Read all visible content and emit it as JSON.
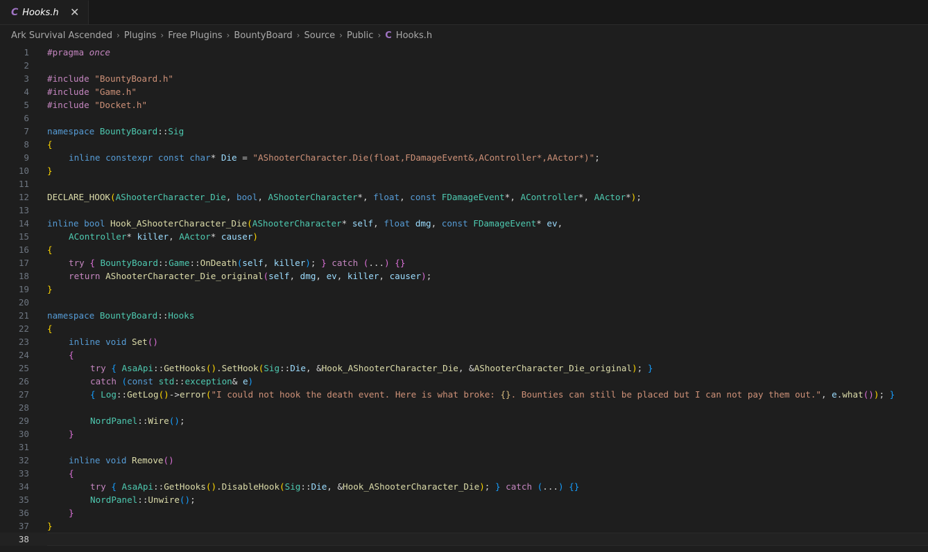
{
  "tab": {
    "icon": "C",
    "title": "Hooks.h",
    "close": "✕"
  },
  "breadcrumbs": [
    "Ark Survival Ascended",
    "Plugins",
    "Free Plugins",
    "BountyBoard",
    "Source",
    "Public"
  ],
  "breadcrumb_file": {
    "icon": "C",
    "label": "Hooks.h"
  },
  "breadcrumb_separator": "›",
  "editor": {
    "current_line": 38,
    "lines": [
      {
        "n": "1",
        "indent": 0,
        "tokens": [
          [
            "pp",
            "#pragma "
          ],
          [
            "pp it",
            "once"
          ]
        ]
      },
      {
        "n": "2",
        "indent": 0,
        "tokens": []
      },
      {
        "n": "3",
        "indent": 0,
        "tokens": [
          [
            "pp",
            "#include "
          ],
          [
            "str",
            "\"BountyBoard.h\""
          ]
        ]
      },
      {
        "n": "4",
        "indent": 0,
        "tokens": [
          [
            "pp",
            "#include "
          ],
          [
            "str",
            "\"Game.h\""
          ]
        ]
      },
      {
        "n": "5",
        "indent": 0,
        "tokens": [
          [
            "pp",
            "#include "
          ],
          [
            "str",
            "\"Docket.h\""
          ]
        ]
      },
      {
        "n": "6",
        "indent": 0,
        "tokens": []
      },
      {
        "n": "7",
        "indent": 0,
        "tokens": [
          [
            "kw",
            "namespace "
          ],
          [
            "ty",
            "BountyBoard"
          ],
          [
            "pl",
            "::"
          ],
          [
            "ty",
            "Sig"
          ]
        ]
      },
      {
        "n": "8",
        "indent": 0,
        "tokens": [
          [
            "br1",
            "{"
          ]
        ]
      },
      {
        "n": "9",
        "indent": 1,
        "tokens": [
          [
            "kw",
            "inline constexpr const char"
          ],
          [
            "pl",
            "* "
          ],
          [
            "var",
            "Die"
          ],
          [
            "pl",
            " = "
          ],
          [
            "str",
            "\"AShooterCharacter.Die(float,FDamageEvent&,AController*,AActor*)\""
          ],
          [
            "pl",
            ";"
          ]
        ]
      },
      {
        "n": "10",
        "indent": 0,
        "tokens": [
          [
            "br1",
            "}"
          ]
        ]
      },
      {
        "n": "11",
        "indent": 0,
        "tokens": []
      },
      {
        "n": "12",
        "indent": 0,
        "tokens": [
          [
            "fn",
            "DECLARE_HOOK"
          ],
          [
            "br1",
            "("
          ],
          [
            "ty",
            "AShooterCharacter_Die"
          ],
          [
            "pl",
            ", "
          ],
          [
            "kw",
            "bool"
          ],
          [
            "pl",
            ", "
          ],
          [
            "ty",
            "AShooterCharacter"
          ],
          [
            "pl",
            "*, "
          ],
          [
            "kw",
            "float"
          ],
          [
            "pl",
            ", "
          ],
          [
            "kw",
            "const "
          ],
          [
            "ty",
            "FDamageEvent"
          ],
          [
            "pl",
            "*, "
          ],
          [
            "ty",
            "AController"
          ],
          [
            "pl",
            "*, "
          ],
          [
            "ty",
            "AActor"
          ],
          [
            "pl",
            "*"
          ],
          [
            "br1",
            ")"
          ],
          [
            "pl",
            ";"
          ]
        ]
      },
      {
        "n": "13",
        "indent": 0,
        "tokens": []
      },
      {
        "n": "14",
        "indent": 0,
        "tokens": [
          [
            "kw",
            "inline bool "
          ],
          [
            "fn",
            "Hook_AShooterCharacter_Die"
          ],
          [
            "br1",
            "("
          ],
          [
            "ty",
            "AShooterCharacter"
          ],
          [
            "pl",
            "* "
          ],
          [
            "var",
            "self"
          ],
          [
            "pl",
            ", "
          ],
          [
            "kw",
            "float "
          ],
          [
            "var",
            "dmg"
          ],
          [
            "pl",
            ", "
          ],
          [
            "kw",
            "const "
          ],
          [
            "ty",
            "FDamageEvent"
          ],
          [
            "pl",
            "* "
          ],
          [
            "var",
            "ev"
          ],
          [
            "pl",
            ","
          ]
        ]
      },
      {
        "n": "15",
        "indent": 1,
        "tokens": [
          [
            "ty",
            "AController"
          ],
          [
            "pl",
            "* "
          ],
          [
            "var",
            "killer"
          ],
          [
            "pl",
            ", "
          ],
          [
            "ty",
            "AActor"
          ],
          [
            "pl",
            "* "
          ],
          [
            "var",
            "causer"
          ],
          [
            "br1",
            ")"
          ]
        ]
      },
      {
        "n": "16",
        "indent": 0,
        "tokens": [
          [
            "br1",
            "{"
          ]
        ]
      },
      {
        "n": "17",
        "indent": 1,
        "tokens": [
          [
            "pp",
            "try "
          ],
          [
            "br2",
            "{ "
          ],
          [
            "ty",
            "BountyBoard"
          ],
          [
            "pl",
            "::"
          ],
          [
            "ty",
            "Game"
          ],
          [
            "pl",
            "::"
          ],
          [
            "fn",
            "OnDeath"
          ],
          [
            "br3",
            "("
          ],
          [
            "var",
            "self"
          ],
          [
            "pl",
            ", "
          ],
          [
            "var",
            "killer"
          ],
          [
            "br3",
            ")"
          ],
          [
            "pl",
            "; "
          ],
          [
            "br2",
            "}"
          ],
          [
            "pl",
            " "
          ],
          [
            "pp",
            "catch "
          ],
          [
            "br2",
            "("
          ],
          [
            "pl",
            "..."
          ],
          [
            "br2",
            ")"
          ],
          [
            "pl",
            " "
          ],
          [
            "br2",
            "{}"
          ]
        ]
      },
      {
        "n": "18",
        "indent": 1,
        "tokens": [
          [
            "pp",
            "return "
          ],
          [
            "fn",
            "AShooterCharacter_Die_original"
          ],
          [
            "br2",
            "("
          ],
          [
            "var",
            "self"
          ],
          [
            "pl",
            ", "
          ],
          [
            "var",
            "dmg"
          ],
          [
            "pl",
            ", "
          ],
          [
            "var",
            "ev"
          ],
          [
            "pl",
            ", "
          ],
          [
            "var",
            "killer"
          ],
          [
            "pl",
            ", "
          ],
          [
            "var",
            "causer"
          ],
          [
            "br2",
            ")"
          ],
          [
            "pl",
            ";"
          ]
        ]
      },
      {
        "n": "19",
        "indent": 0,
        "tokens": [
          [
            "br1",
            "}"
          ]
        ]
      },
      {
        "n": "20",
        "indent": 0,
        "tokens": []
      },
      {
        "n": "21",
        "indent": 0,
        "tokens": [
          [
            "kw",
            "namespace "
          ],
          [
            "ty",
            "BountyBoard"
          ],
          [
            "pl",
            "::"
          ],
          [
            "ty",
            "Hooks"
          ]
        ]
      },
      {
        "n": "22",
        "indent": 0,
        "tokens": [
          [
            "br1",
            "{"
          ]
        ]
      },
      {
        "n": "23",
        "indent": 1,
        "tokens": [
          [
            "kw",
            "inline void "
          ],
          [
            "fn",
            "Set"
          ],
          [
            "br2",
            "()"
          ]
        ]
      },
      {
        "n": "24",
        "indent": 1,
        "tokens": [
          [
            "br2",
            "{"
          ]
        ]
      },
      {
        "n": "25",
        "indent": 2,
        "tokens": [
          [
            "pp",
            "try "
          ],
          [
            "br3",
            "{ "
          ],
          [
            "ty",
            "AsaApi"
          ],
          [
            "pl",
            "::"
          ],
          [
            "fn",
            "GetHooks"
          ],
          [
            "br1",
            "()"
          ],
          [
            "pl",
            "."
          ],
          [
            "fn",
            "SetHook"
          ],
          [
            "br1",
            "("
          ],
          [
            "ty",
            "Sig"
          ],
          [
            "pl",
            "::"
          ],
          [
            "var",
            "Die"
          ],
          [
            "pl",
            ", &"
          ],
          [
            "fn",
            "Hook_AShooterCharacter_Die"
          ],
          [
            "pl",
            ", &"
          ],
          [
            "fn",
            "AShooterCharacter_Die_original"
          ],
          [
            "br1",
            ")"
          ],
          [
            "pl",
            "; "
          ],
          [
            "br3",
            "}"
          ]
        ]
      },
      {
        "n": "26",
        "indent": 2,
        "tokens": [
          [
            "pp",
            "catch "
          ],
          [
            "br3",
            "("
          ],
          [
            "kw",
            "const "
          ],
          [
            "ty",
            "std"
          ],
          [
            "pl",
            "::"
          ],
          [
            "ty",
            "exception"
          ],
          [
            "pl",
            "& "
          ],
          [
            "var",
            "e"
          ],
          [
            "br3",
            ")"
          ]
        ]
      },
      {
        "n": "27",
        "indent": 2,
        "tokens": [
          [
            "br3",
            "{ "
          ],
          [
            "ty",
            "Log"
          ],
          [
            "pl",
            "::"
          ],
          [
            "fn",
            "GetLog"
          ],
          [
            "br1",
            "()"
          ],
          [
            "pl",
            "->"
          ],
          [
            "fn",
            "error"
          ],
          [
            "br1",
            "("
          ],
          [
            "str",
            "\"I could not hook the death event. Here is what broke: "
          ],
          [
            "strg",
            "{}"
          ],
          [
            "str",
            ". Bounties can still be placed but I can not pay them out.\""
          ],
          [
            "pl",
            ", "
          ],
          [
            "var",
            "e"
          ],
          [
            "pl",
            "."
          ],
          [
            "fn",
            "what"
          ],
          [
            "br2",
            "()"
          ],
          [
            "br1",
            ")"
          ],
          [
            "pl",
            "; "
          ],
          [
            "br3",
            "}"
          ]
        ]
      },
      {
        "n": "28",
        "indent": 2,
        "tokens": []
      },
      {
        "n": "29",
        "indent": 2,
        "tokens": [
          [
            "ty",
            "NordPanel"
          ],
          [
            "pl",
            "::"
          ],
          [
            "fn",
            "Wire"
          ],
          [
            "br3",
            "()"
          ],
          [
            "pl",
            ";"
          ]
        ]
      },
      {
        "n": "30",
        "indent": 1,
        "tokens": [
          [
            "br2",
            "}"
          ]
        ]
      },
      {
        "n": "31",
        "indent": 1,
        "tokens": []
      },
      {
        "n": "32",
        "indent": 1,
        "tokens": [
          [
            "kw",
            "inline void "
          ],
          [
            "fn",
            "Remove"
          ],
          [
            "br2",
            "()"
          ]
        ]
      },
      {
        "n": "33",
        "indent": 1,
        "tokens": [
          [
            "br2",
            "{"
          ]
        ]
      },
      {
        "n": "34",
        "indent": 2,
        "tokens": [
          [
            "pp",
            "try "
          ],
          [
            "br3",
            "{ "
          ],
          [
            "ty",
            "AsaApi"
          ],
          [
            "pl",
            "::"
          ],
          [
            "fn",
            "GetHooks"
          ],
          [
            "br1",
            "()"
          ],
          [
            "pl",
            "."
          ],
          [
            "fn",
            "DisableHook"
          ],
          [
            "br1",
            "("
          ],
          [
            "ty",
            "Sig"
          ],
          [
            "pl",
            "::"
          ],
          [
            "var",
            "Die"
          ],
          [
            "pl",
            ", &"
          ],
          [
            "fn",
            "Hook_AShooterCharacter_Die"
          ],
          [
            "br1",
            ")"
          ],
          [
            "pl",
            "; "
          ],
          [
            "br3",
            "}"
          ],
          [
            "pl",
            " "
          ],
          [
            "pp",
            "catch "
          ],
          [
            "br3",
            "("
          ],
          [
            "pl",
            "..."
          ],
          [
            "br3",
            ")"
          ],
          [
            "pl",
            " "
          ],
          [
            "br3",
            "{}"
          ]
        ]
      },
      {
        "n": "35",
        "indent": 2,
        "tokens": [
          [
            "ty",
            "NordPanel"
          ],
          [
            "pl",
            "::"
          ],
          [
            "fn",
            "Unwire"
          ],
          [
            "br3",
            "()"
          ],
          [
            "pl",
            ";"
          ]
        ]
      },
      {
        "n": "36",
        "indent": 1,
        "tokens": [
          [
            "br2",
            "}"
          ]
        ]
      },
      {
        "n": "37",
        "indent": 0,
        "tokens": [
          [
            "br1",
            "}"
          ]
        ]
      },
      {
        "n": "38",
        "indent": 0,
        "tokens": []
      }
    ]
  }
}
